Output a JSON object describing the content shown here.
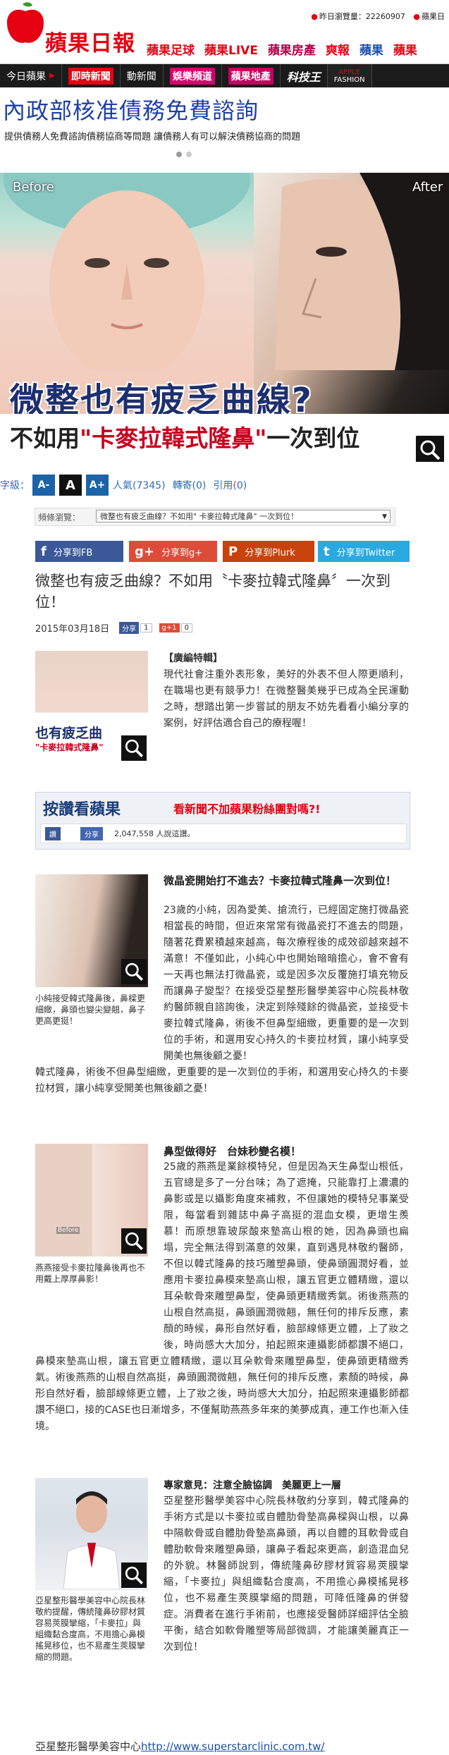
{
  "header": {
    "logo_text": "蘋果日報",
    "links": [
      "昨日瀏覽量：22260907",
      "蘋果日"
    ],
    "brands": [
      {
        "label": "蘋果足球",
        "color": "#e50012"
      },
      {
        "label": "蘋果LIVE",
        "color": "#e50012"
      },
      {
        "label": "蘋果房產",
        "color": "#b0004a"
      },
      {
        "label": "爽報",
        "color": "#e50012"
      },
      {
        "label": "蘋果",
        "color": "#1c4fa8"
      },
      {
        "label": "蘋果",
        "color": "#e50012"
      }
    ]
  },
  "nav": {
    "items": [
      "今日蘋果",
      "即時新聞",
      "動新聞",
      "娛樂頻道",
      "蘋果地產",
      "科技王"
    ],
    "fashion": [
      "APPLE",
      "FASHION"
    ]
  },
  "ad": {
    "title": "內政部核准債務免費諮詢",
    "subtitle": "提供債務人免費諮詢債務協商等問題 讓債務人有可以解決債務協商的問題"
  },
  "hero": {
    "before": "Before",
    "after": "After",
    "title1": "微整也有疲乏曲線?",
    "title2_prefix": "不如用",
    "title2_quote": "\"卡麥拉韓式隆鼻\"",
    "title2_suffix": "一次到位"
  },
  "toolbar": {
    "font_label": "字級：",
    "font_small": "A-",
    "font_normal": "A",
    "font_large": "A+",
    "views": "人氣(7345)",
    "reposts": "轉寄(0)",
    "cites": "引用(0)"
  },
  "crumb": {
    "label": "頻條瀏覽：",
    "selected": "微整也有疲乏曲線？不如用\" 卡麥拉韓式隆鼻\" 一次到位！"
  },
  "share": {
    "fb": "分享到FB",
    "g": "分享到g+",
    "plurk": "分享到Plurk",
    "twitter": "分享到Twitter"
  },
  "article": {
    "headline": "微整也有疲乏曲線？不如用〝卡麥拉韓式隆鼻〞一次到位！",
    "date": "2015年03月18日",
    "fb_share_label": "分享",
    "fb_count": "1",
    "g_label": "g+1",
    "g_count": "0",
    "p1_tag": "【廣編特輯】",
    "p1": "現代社會注重外表形象，美好的外表不但人際更順利，在職場也更有競爭力！在微整醫美幾乎已成為全民運動之時，想踏出第一步嘗試的朋友不妨先看看小編分享的案例，好評估適合自己的療程喔！",
    "follow_title": "按讚看蘋果",
    "follow_hot": "看新聞不加蘋果粉絲團對嗎?!",
    "follow_like": "讚",
    "follow_share": "分享",
    "follow_count": "2,047,558 人說這讚。",
    "s1_title": "微晶瓷開始打不進去？卡麥拉韓式隆鼻一次到位！",
    "s1": "23歲的小純，因為愛美、搶流行，已經固定施打微晶瓷相當長的時間，但近來常常有微晶瓷打不進去的問題，隨著花費累積越來越高，每次療程後的成效卻越來越不滿意！不僅如此，小純心中也開始暗暗擔心，會不會有一天再也無法打微晶瓷，或是因多次反覆施打填充物反而讓鼻子變型？在接受亞星整形醫學美容中心院長林敬約醫師親自諮詢後，決定到除殘餘的微晶瓷，並接受卡麥拉韓式隆鼻，術後不但鼻型細緻，更重要的是一次到位的手術，和選用安心持久的卡麥拉材質，讓小純享受開美也無後顧之憂！",
    "s1_cap": "小純接受韓式隆鼻後，鼻樑更細緻，鼻頭也變尖變翹，鼻子更高更挺！",
    "s2_title": "鼻型做得好　台妹秒變名模！",
    "s2": "25歲的燕燕是業餘模特兒，但是因為天生鼻型山根低，五官總是多了一分台味；為了遮掩，只能靠打上濃濃的鼻影或是以攝影角度來補救，不但讓她的模特兒事業受限，每當看到雜誌中鼻子高挺的混血女模，更增生羨慕！而原想靠玻尿酸來墊高山根的她，因為鼻頭也扁塌，完全無法得到滿意的效果，直到遇見林敬約醫師，不但以韓式隆鼻的技巧雕塑鼻頭，使鼻頭圓潤好看，並應用卡麥拉鼻模來墊高山根，讓五官更立體精緻，還以耳朵軟骨來雕塑鼻型，使鼻頭更精緻秀氣。術後燕燕的山根自然高挺，鼻頭圓潤微翹，無任何的排斥反應，素顏的時候，鼻形自然好看，臉部線條更立體，上了妝之後，時尚感大大加分，拍起照來連攝影師都讚不絕口，接的CASE也日漸增多，不僅幫助燕燕多年來的美夢成真，連工作也漸入佳境。",
    "s2_cap": "燕燕接受卡麥拉隆鼻後再也不用戴上厚厚鼻影！",
    "s2_before": "Before",
    "s3_title": "專家意見：注意全臉協調　美麗更上一層",
    "s3": "亞星整形醫學美容中心院長林敬約分享到，韓式隆鼻的手術方式是以卡麥拉或自體肋骨墊高鼻樑與山根，以鼻中隔軟骨或自體肋骨墊高鼻頭，再以自體的耳軟骨或自體肋軟骨來雕塑鼻頭，讓鼻子看起來更高，創造混血兒的外貌。林醫師說到，傳統隆鼻矽膠材質容易莢膜攣縮，「卡麥拉」與組織黏合度高，不用擔心鼻模搖晃移位，也不易產生莢膜攣縮的問題，可降低隆鼻的併發症。消費者在進行手術前，也應接受醫師詳細評估全臉平衡，結合如軟骨雕塑等局部微調，才能讓美麗真正一次到位！",
    "s3_cap": "亞星整形醫學美容中心院長林敬約提醒，傳統隆鼻矽膠材質容易莢膜攣縮，「卡麥拉」與組織黏合度高，不用擔心鼻模搖晃移位，也不易產生莢膜攣縮的問題。",
    "footer_text": "亞星整形醫學美容中心",
    "footer_link": "http://www.superstarclinic.com.tw/"
  }
}
